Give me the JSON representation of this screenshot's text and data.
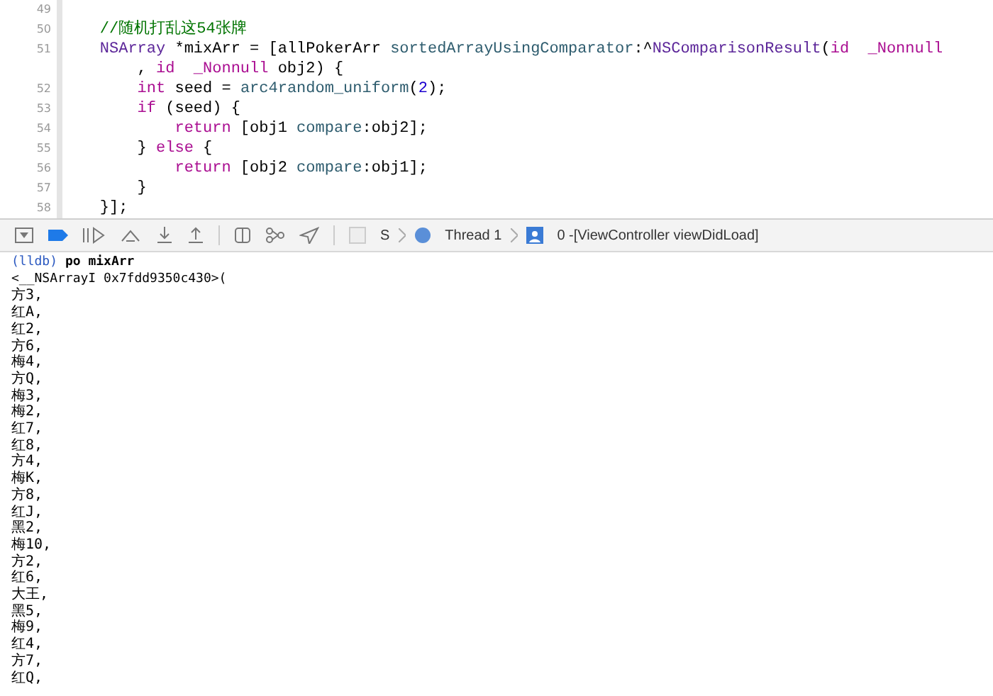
{
  "editor": {
    "lines": [
      {
        "number": "49"
      },
      {
        "number": "50",
        "visual_lines": [
          {
            "tokens": [
              {
                "kind": "comment",
                "text": "    //随机打乱这54张牌"
              }
            ]
          }
        ]
      },
      {
        "number": "51",
        "visual_lines": [
          {
            "tokens": [
              {
                "kind": "type",
                "text": "    NSArray"
              },
              {
                "kind": "plain",
                "text": " *mixArr = [allPokerArr "
              },
              {
                "kind": "method",
                "text": "sortedArrayUsingComparator"
              },
              {
                "kind": "plain",
                "text": ":^"
              },
              {
                "kind": "type",
                "text": "NSComparisonResult"
              },
              {
                "kind": "plain",
                "text": "("
              },
              {
                "kind": "keyword",
                "text": "id"
              },
              {
                "kind": "keyword",
                "text": "  _Nonnull"
              }
            ]
          },
          {
            "tokens": [
              {
                "kind": "plain",
                "text": "        , "
              },
              {
                "kind": "keyword",
                "text": "id"
              },
              {
                "kind": "keyword",
                "text": "  _Nonnull"
              },
              {
                "kind": "plain",
                "text": " obj2) {"
              }
            ]
          }
        ]
      },
      {
        "number": "52",
        "visual_lines": [
          {
            "tokens": [
              {
                "kind": "keyword",
                "text": "        int"
              },
              {
                "kind": "plain",
                "text": " seed = "
              },
              {
                "kind": "method",
                "text": "arc4random_uniform"
              },
              {
                "kind": "plain",
                "text": "("
              },
              {
                "kind": "number",
                "text": "2"
              },
              {
                "kind": "plain",
                "text": ");"
              }
            ]
          }
        ]
      },
      {
        "number": "53",
        "visual_lines": [
          {
            "tokens": [
              {
                "kind": "keyword",
                "text": "        if"
              },
              {
                "kind": "plain",
                "text": " (seed) {"
              }
            ]
          }
        ]
      },
      {
        "number": "54",
        "visual_lines": [
          {
            "tokens": [
              {
                "kind": "keyword",
                "text": "            return"
              },
              {
                "kind": "plain",
                "text": " [obj1 "
              },
              {
                "kind": "method",
                "text": "compare"
              },
              {
                "kind": "plain",
                "text": ":obj2];"
              }
            ]
          }
        ]
      },
      {
        "number": "55",
        "visual_lines": [
          {
            "tokens": [
              {
                "kind": "plain",
                "text": "        } "
              },
              {
                "kind": "keyword",
                "text": "else"
              },
              {
                "kind": "plain",
                "text": " {"
              }
            ]
          }
        ]
      },
      {
        "number": "56",
        "visual_lines": [
          {
            "tokens": [
              {
                "kind": "keyword",
                "text": "            return"
              },
              {
                "kind": "plain",
                "text": " [obj2 "
              },
              {
                "kind": "method",
                "text": "compare"
              },
              {
                "kind": "plain",
                "text": ":obj1];"
              }
            ]
          }
        ]
      },
      {
        "number": "57",
        "visual_lines": [
          {
            "tokens": [
              {
                "kind": "plain",
                "text": "        }"
              }
            ]
          }
        ]
      },
      {
        "number": "58",
        "visual_lines": [
          {
            "tokens": [
              {
                "kind": "plain",
                "text": "    }];"
              }
            ]
          }
        ]
      }
    ]
  },
  "debug_bar": {
    "scheme_label": "S",
    "thread": "Thread 1",
    "frame": "0 -[ViewController viewDidLoad]"
  },
  "console": {
    "prompt": "(lldb)",
    "command": "po mixArr",
    "output_header": "<__NSArrayI 0x7fdd9350c430>(",
    "items": [
      "方3,",
      "红A,",
      "红2,",
      "方6,",
      "梅4,",
      "方Q,",
      "梅3,",
      "梅2,",
      "红7,",
      "红8,",
      "方4,",
      "梅K,",
      "方8,",
      "红J,",
      "黑2,",
      "梅10,",
      "方2,",
      "红6,",
      "大王,",
      "黑5,",
      "梅9,",
      "红4,",
      "方7,",
      "红Q,"
    ]
  }
}
